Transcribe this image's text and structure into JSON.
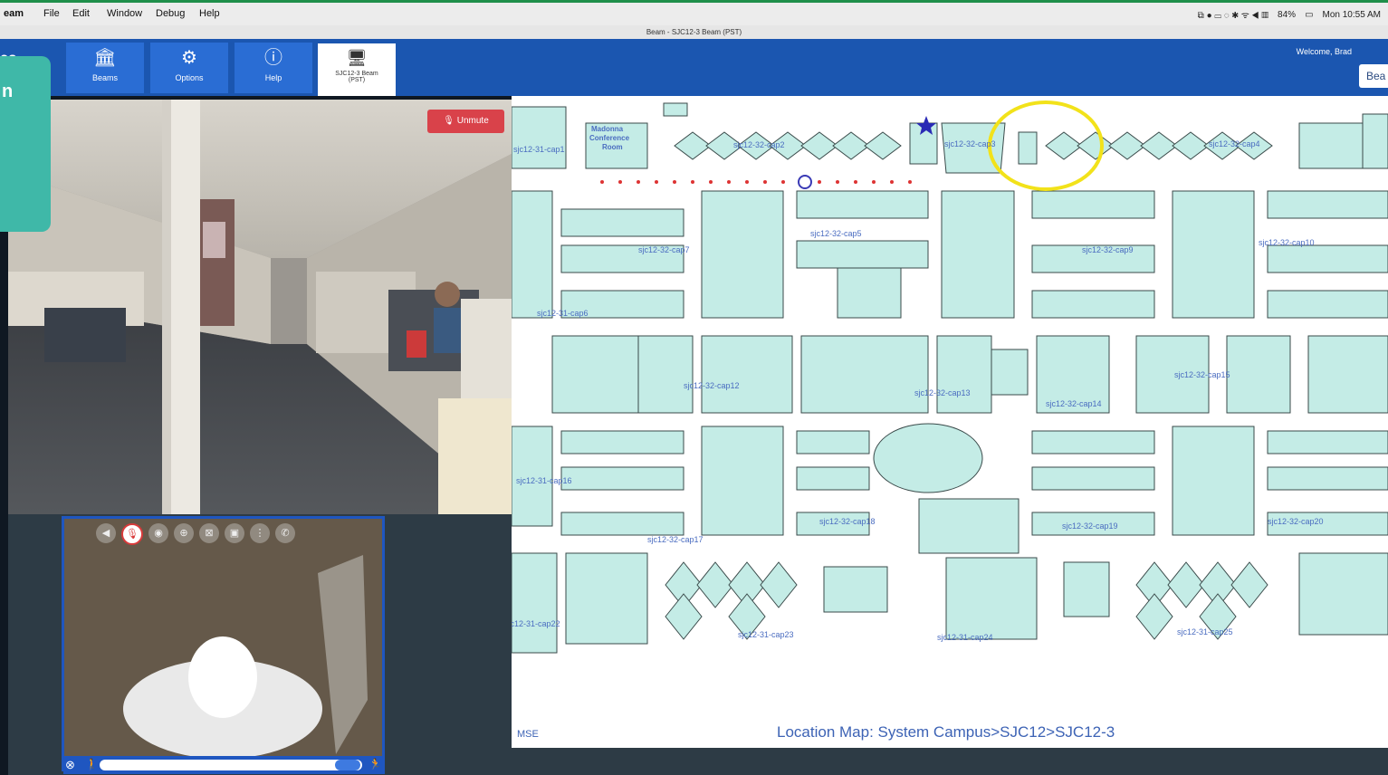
{
  "menubar": {
    "app": "eam",
    "items": [
      "File",
      "Edit",
      "Window",
      "Debug",
      "Help"
    ],
    "battery": "84%",
    "clock": "Mon 10:55 AM"
  },
  "window_title": "Beam - SJC12-3 Beam (PST)",
  "toolbar": {
    "logo_fragment": "co",
    "buttons": [
      {
        "label": "Beams",
        "icon": "building-icon"
      },
      {
        "label": "Options",
        "icon": "gear-icon"
      },
      {
        "label": "Help",
        "icon": "help-icon"
      }
    ],
    "active_tab_line1": "SJC12-3 Beam",
    "active_tab_line2": "(PST)",
    "welcome": "Welcome, Brad",
    "beam_button": "Bea"
  },
  "overlay_text": "n",
  "camera": {
    "unmute_label": "Unmute"
  },
  "map": {
    "caption": "Location Map: System Campus>SJC12>SJC12-3",
    "corner_label": "MSE",
    "room_labels": [
      "Madonna",
      "Conference",
      "Room"
    ],
    "labels": [
      "sjc12-31-cap1",
      "sjc12-32-cap2",
      "sjc12-32-cap3",
      "sjc12-32-cap4",
      "sjc12-32-cap5",
      "sjc12-32-cap7",
      "sjc12-32-cap9",
      "sjc12-32-cap10",
      "sjc12-31-cap6",
      "sjc12-32-cap12",
      "sjc12-32-cap13",
      "sjc12-32-cap14",
      "sjc12-32-cap15",
      "sjc12-31-cap16",
      "sjc12-32-cap17",
      "sjc12-32-cap18",
      "sjc12-32-cap19",
      "sjc12-32-cap20",
      "sjc12-31-cap22",
      "sjc12-31-cap23",
      "sjc12-31-cap24",
      "sjc12-31-cap25"
    ]
  }
}
